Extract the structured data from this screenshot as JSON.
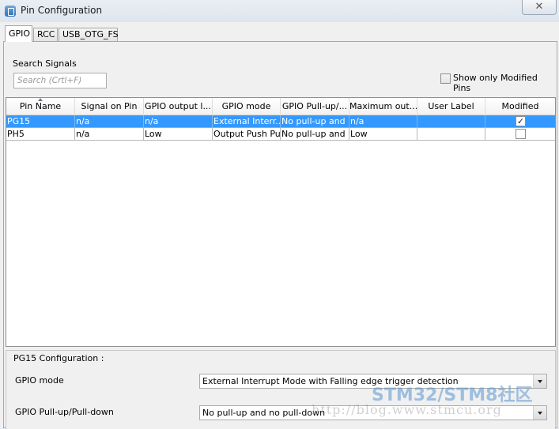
{
  "window": {
    "title": "Pin Configuration",
    "close_glyph": "✕"
  },
  "tabs": [
    {
      "label": "GPIO",
      "active": true
    },
    {
      "label": "RCC",
      "active": false
    },
    {
      "label": "USB_OTG_FS",
      "active": false
    }
  ],
  "search": {
    "label": "Search Signals",
    "placeholder": "Search (Crtl+F)",
    "value": ""
  },
  "filter": {
    "label": "Show only Modified Pins",
    "checked": false
  },
  "table": {
    "columns": [
      "Pin Name",
      "Signal on Pin",
      "GPIO output l...",
      "GPIO mode",
      "GPIO Pull-up/...",
      "Maximum out...",
      "User Label",
      "Modified"
    ],
    "sorted_column": "Pin Name",
    "rows": [
      {
        "pin": "PG15",
        "signal": "n/a",
        "output_level": "n/a",
        "mode": "External Interr...",
        "pull": "No pull-up and ...",
        "max_speed": "n/a",
        "user_label": "",
        "modified": true,
        "selected": true
      },
      {
        "pin": "PH5",
        "signal": "n/a",
        "output_level": "Low",
        "mode": "Output Push Pull",
        "pull": "No pull-up and ...",
        "max_speed": "Low",
        "user_label": "",
        "modified": false,
        "selected": false
      }
    ]
  },
  "config": {
    "title": "PG15 Configuration :",
    "fields": [
      {
        "label": "GPIO mode",
        "value": "External Interrupt Mode with Falling edge trigger detection"
      },
      {
        "label": "GPIO Pull-up/Pull-down",
        "value": "No pull-up and no pull-down"
      }
    ]
  },
  "watermark": {
    "brand": "STM32/STM8社区",
    "url": "http://blog.www.stmcu.org"
  },
  "colors": {
    "selection": "#3399ff",
    "watermark": "#5a96d2"
  },
  "icons": {
    "checkmark": "✓"
  }
}
